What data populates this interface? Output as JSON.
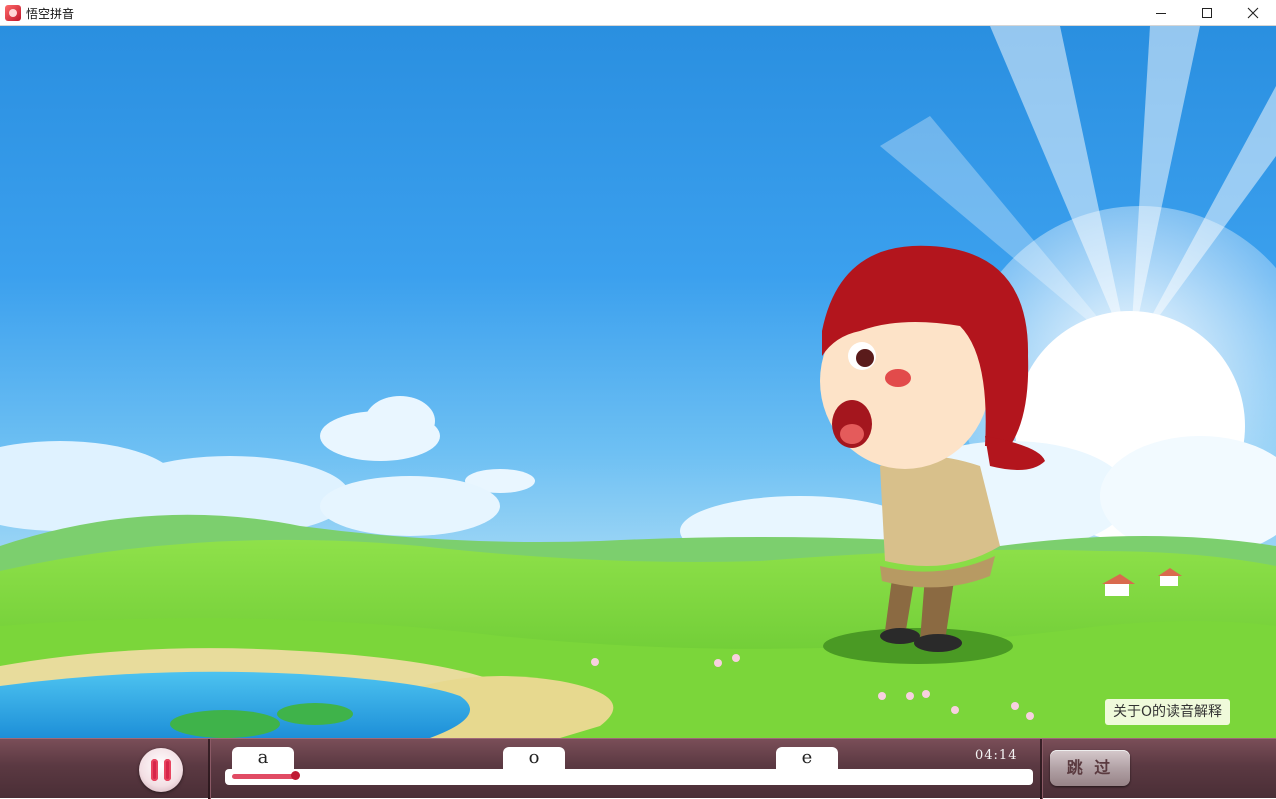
{
  "window": {
    "title": "悟空拼音",
    "icon": "app-logo-icon",
    "controls": [
      "minimize-icon",
      "maximize-icon",
      "close-icon"
    ]
  },
  "scene": {
    "tip_text": "关于O的读音解释"
  },
  "player": {
    "chapters": [
      {
        "label": "a"
      },
      {
        "label": "o"
      },
      {
        "label": "e"
      }
    ],
    "time": "04:14",
    "progress": 0.08,
    "skip_label": "跳 过",
    "colors": {
      "bar": "#5b3942",
      "progress": "#e14b64",
      "pause": "#d7264a"
    }
  }
}
